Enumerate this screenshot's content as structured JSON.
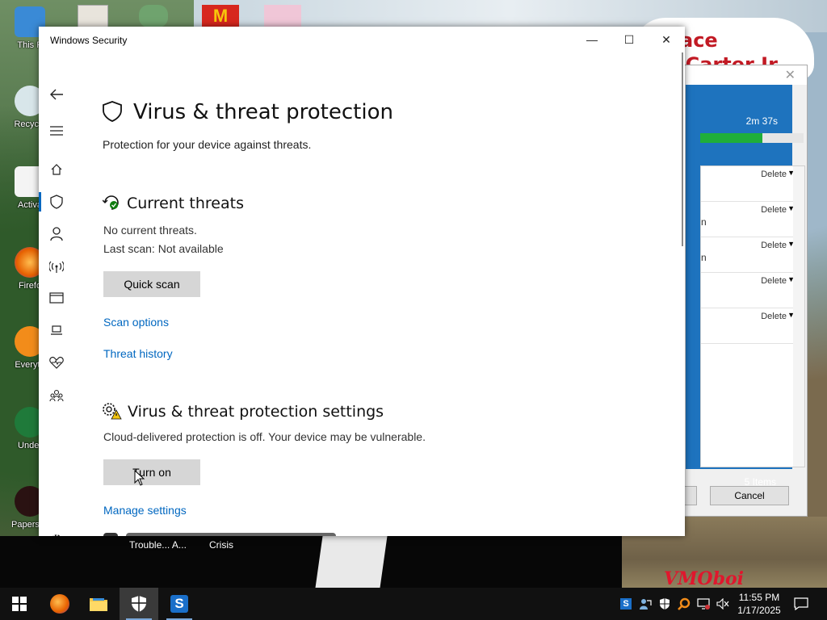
{
  "desktop": {
    "icons": [
      {
        "label": "This P",
        "name": "this-pc"
      },
      {
        "label": "Recycle",
        "name": "recycle-bin"
      },
      {
        "label": "Activa",
        "name": "activate"
      },
      {
        "label": "Firefo",
        "name": "firefox"
      },
      {
        "label": "Everyth",
        "name": "everything"
      },
      {
        "label": "Under",
        "name": "undertale"
      },
      {
        "label": "Papers, P",
        "name": "papers-please"
      }
    ],
    "dock_labels": [
      "Trouble... A...",
      "Crisis"
    ],
    "cheer_text": [
      "ace",
      "l Carter Jr"
    ],
    "watermark": "VMOboi"
  },
  "background_dialog": {
    "time_left": "2m 37s",
    "progress": 0.6,
    "rows": [
      {
        "action": "Delete",
        "suffix": ""
      },
      {
        "action": "Delete",
        "suffix": "n"
      },
      {
        "action": "Delete",
        "suffix": "n"
      },
      {
        "action": "Delete",
        "suffix": ""
      },
      {
        "action": "Delete",
        "suffix": ""
      }
    ],
    "items_count": "5 Items",
    "cancel_label": "Cancel"
  },
  "window": {
    "title": "Windows Security",
    "minimize": "—",
    "maximize": "☐",
    "close": "✕"
  },
  "page": {
    "title": "Virus & threat protection",
    "subtitle": "Protection for your device against threats.",
    "current_threats": {
      "heading": "Current threats",
      "status": "No current threats.",
      "last_scan": "Last scan: Not available",
      "quick_scan_label": "Quick scan",
      "scan_options_link": "Scan options",
      "threat_history_link": "Threat history"
    },
    "settings": {
      "heading": "Virus & threat protection settings",
      "warning": "Cloud-delivered protection is off. Your device may be vulnerable.",
      "turn_on_label": "Turn on",
      "manage_link": "Manage settings"
    }
  },
  "taskbar": {
    "time": "11:55 PM",
    "date": "1/17/2025"
  },
  "colors": {
    "accent": "#0067c0",
    "button_bg": "#d6d6d6",
    "taskbar_bg": "#111111"
  }
}
